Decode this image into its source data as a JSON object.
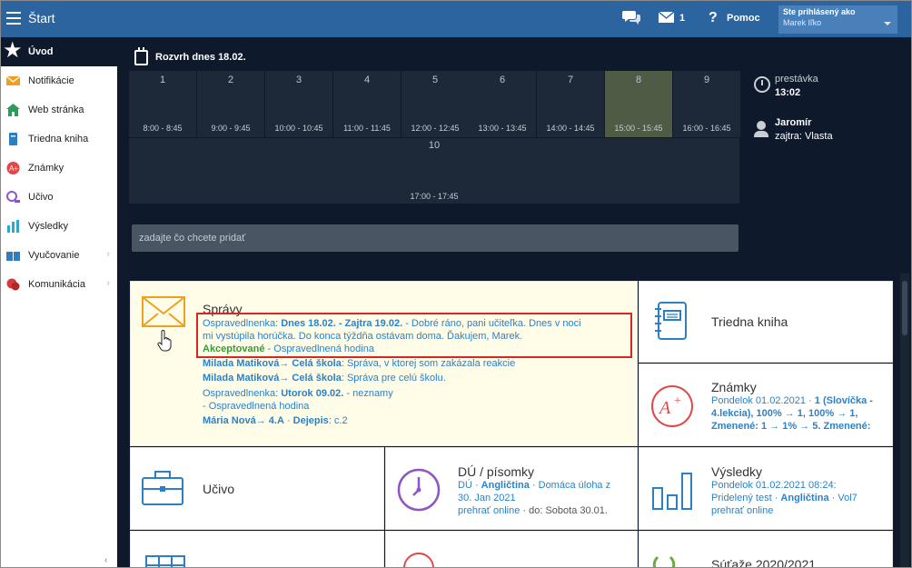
{
  "topbar": {
    "title": "Štart",
    "mail_count": "1",
    "help_label": "Pomoc",
    "user_status": "Ste prihlásený ako",
    "user_name": "Marek Iľko"
  },
  "sidebar": {
    "items": [
      {
        "label": "Úvod",
        "icon": "star-icon"
      },
      {
        "label": "Notifikácie",
        "icon": "envelope-icon"
      },
      {
        "label": "Web stránka",
        "icon": "home-icon"
      },
      {
        "label": "Triedna kniha",
        "icon": "book-icon"
      },
      {
        "label": "Známky",
        "icon": "grade-icon"
      },
      {
        "label": "Učivo",
        "icon": "learning-icon"
      },
      {
        "label": "Výsledky",
        "icon": "results-icon"
      },
      {
        "label": "Vyučovanie",
        "icon": "teaching-icon"
      },
      {
        "label": "Komunikácia",
        "icon": "chat-icon"
      }
    ],
    "bottom_glyph": "‹"
  },
  "schedule": {
    "title": "Rozvrh dnes 18.02.",
    "current_lesson": "8",
    "lessons": [
      {
        "num": "1",
        "time": "8:00 - 8:45"
      },
      {
        "num": "2",
        "time": "9:00 - 9:45"
      },
      {
        "num": "3",
        "time": "10:00 - 10:45"
      },
      {
        "num": "4",
        "time": "11:00 - 11:45"
      },
      {
        "num": "5",
        "time": "12:00 - 12:45"
      },
      {
        "num": "6",
        "time": "13:00 - 13:45"
      },
      {
        "num": "7",
        "time": "14:00 - 14:45"
      },
      {
        "num": "8",
        "time": "15:00 - 15:45"
      },
      {
        "num": "9",
        "time": "16:00 - 16:45"
      },
      {
        "num": "10",
        "time": "17:00 - 17:45"
      }
    ],
    "break_label": "prestávka",
    "break_time": "13:02",
    "teacher_name": "Jaromír",
    "teacher_next": "zajtra: Vlasta",
    "add_placeholder": "zadajte čo chcete pridať"
  },
  "tiles": {
    "spravy": {
      "title": "Správy",
      "m1_prefix": "Ospravedlnenka: ",
      "m1_dates": "Dnes 18.02. - Zajtra 19.02.",
      "m1_text": " - Dobré ráno, pani učiteľka. Dnes v noci",
      "m1_text2": "mi vystúpila horúčka. Do konca týždňa ostávam doma. Ďakujem, Marek.",
      "m1_status": "Akceptované",
      "m1_status_text": " - Ospravedlnená hodina",
      "m2_from": "Milada Matiková",
      "m2_to": "Celá škola",
      "m2_text": ": Správa, v ktorej som zakázala reakcie",
      "m3_from": "Milada Matiková",
      "m3_to": "Celá škola",
      "m3_text": ": Správa pre celú školu.",
      "m4_prefix": "Ospravedlnenka: ",
      "m4_date": "Utorok 09.02.",
      "m4_text": " - neznamy",
      "m4_text2": "- Ospravedlnená hodina",
      "m5_from": "Mária Nová",
      "m5_to": "4.A",
      "m5_subject": "Dejepis",
      "m5_text": ": c.2",
      "arrow": "→"
    },
    "triedna": {
      "title": "Triedna kniha"
    },
    "znamky": {
      "title": "Známky",
      "line1": "Pondelok 01.02.2021 · ",
      "line1b": "1 (Slovíčka -",
      "line2": "4.lekcia), 100% → 1, 100% → 1,",
      "line3": "Zmenené: 1 → 1% → 5. Zmenené:"
    },
    "ucivo": {
      "title": "Učivo"
    },
    "du": {
      "title": "DÚ / písomky",
      "line1a": "DÚ · ",
      "line1b": "Angličtina",
      "line1c": " · Domáca úloha z",
      "line2": "30. Jan 2021",
      "line3a": "prehrať online",
      "line3b": " · do: Sobota 30.01."
    },
    "vysledky": {
      "title": "Výsledky",
      "line1": "Pondelok 01.02.2021 08:24:",
      "line2a": "Pridelený test · ",
      "line2b": "Angličtina",
      "line2c": " · Vol7",
      "line3": "prehrať online"
    },
    "sutaze": {
      "title": "Súťaže 2020/2021"
    }
  },
  "colors": {
    "topbar": "#2c64a0",
    "dark_bg": "#0e1a2b",
    "cell_bg": "#1d2938",
    "current_cell": "#4f5b45",
    "link_blue": "#2b82c8",
    "accepted_green": "#3a9a3a",
    "highlight_red": "#d42727"
  }
}
